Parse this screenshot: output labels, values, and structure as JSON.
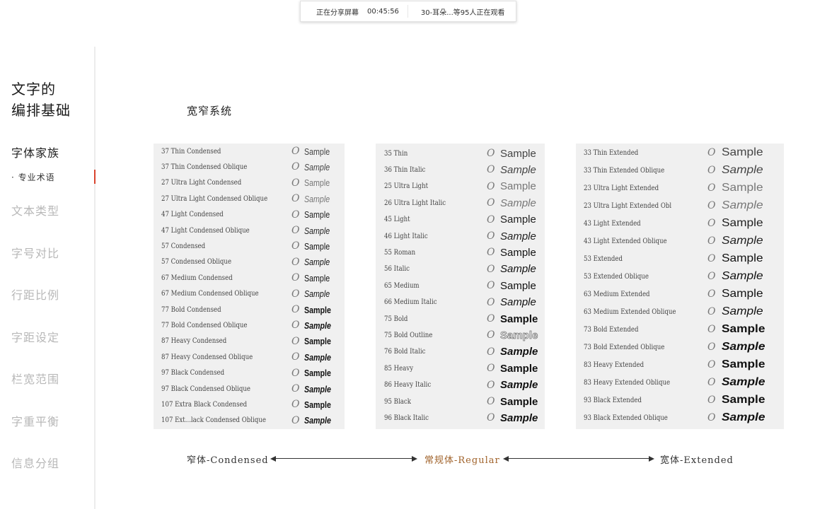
{
  "share_bar": {
    "status": "正在分享屏幕",
    "elapsed": "00:45:56",
    "viewers": "30-耳朵...等95人正在观看"
  },
  "sidebar": {
    "title_line1": "文字的",
    "title_line2": "编排基础",
    "items": [
      {
        "label": "字体家族",
        "state": "active"
      },
      {
        "label": "· 专业术语",
        "state": "current-sub"
      },
      {
        "label": "文本类型",
        "state": "inactive"
      },
      {
        "label": "字号对比",
        "state": "inactive"
      },
      {
        "label": "行距比例",
        "state": "inactive"
      },
      {
        "label": "字距设定",
        "state": "inactive"
      },
      {
        "label": "栏宽范围",
        "state": "inactive"
      },
      {
        "label": "字重平衡",
        "state": "inactive"
      },
      {
        "label": "信息分组",
        "state": "inactive"
      }
    ],
    "marker_color": "#d9442e"
  },
  "main": {
    "section_title": "宽窄系统",
    "glyph": "O",
    "sample_text": "Sample",
    "condensed": [
      {
        "name": "37 Thin Condensed",
        "style": "w100"
      },
      {
        "name": "37 Thin Condensed Oblique",
        "style": "w100 it"
      },
      {
        "name": "27 Ultra Light Condensed",
        "style": "w200"
      },
      {
        "name": "27 Ultra Light Condensed Oblique",
        "style": "w200 it"
      },
      {
        "name": "47 Light Condensed",
        "style": "w300"
      },
      {
        "name": "47 Light Condensed Oblique",
        "style": "w300 it"
      },
      {
        "name": "57 Condensed",
        "style": "w400"
      },
      {
        "name": "57 Condensed Oblique",
        "style": "w400 it"
      },
      {
        "name": "67 Medium Condensed",
        "style": "w500"
      },
      {
        "name": "67 Medium Condensed Oblique",
        "style": "w500 it"
      },
      {
        "name": "77 Bold Condensed",
        "style": "w700"
      },
      {
        "name": "77 Bold Condensed Oblique",
        "style": "w700 it"
      },
      {
        "name": "87 Heavy Condensed",
        "style": "w800"
      },
      {
        "name": "87 Heavy Condensed Oblique",
        "style": "w800 it"
      },
      {
        "name": "97 Black Condensed",
        "style": "w900"
      },
      {
        "name": "97 Black Condensed Oblique",
        "style": "w900 it"
      },
      {
        "name": "107 Extra Black Condensed",
        "style": "w900"
      },
      {
        "name": "107 Ext...lack Condensed Oblique",
        "style": "w900 it"
      }
    ],
    "regular": [
      {
        "name": "35 Thin",
        "style": "w100"
      },
      {
        "name": "36 Thin Italic",
        "style": "w100 it"
      },
      {
        "name": "25 Ultra Light",
        "style": "w200"
      },
      {
        "name": "26 Ultra Light Italic",
        "style": "w200 it"
      },
      {
        "name": "45 Light",
        "style": "w300"
      },
      {
        "name": "46 Light Italic",
        "style": "w300 it"
      },
      {
        "name": "55 Roman",
        "style": "w400"
      },
      {
        "name": "56 Italic",
        "style": "w400 it"
      },
      {
        "name": "65 Medium",
        "style": "w500"
      },
      {
        "name": "66 Medium Italic",
        "style": "w500 it"
      },
      {
        "name": "75 Bold",
        "style": "w700"
      },
      {
        "name": "75 Bold Outline",
        "style": "outline"
      },
      {
        "name": "76 Bold Italic",
        "style": "w700 it"
      },
      {
        "name": "85 Heavy",
        "style": "w800"
      },
      {
        "name": "86 Heavy Italic",
        "style": "w800 it"
      },
      {
        "name": "95 Black",
        "style": "w900"
      },
      {
        "name": "96 Black Italic",
        "style": "w900 it"
      }
    ],
    "extended": [
      {
        "name": "33 Thin Extended",
        "style": "w100"
      },
      {
        "name": "33 Thin Extended Oblique",
        "style": "w100 it"
      },
      {
        "name": "23 Ultra Light Extended",
        "style": "w200"
      },
      {
        "name": "23 Ultra Light Extended Obl",
        "style": "w200 it"
      },
      {
        "name": "43 Light Extended",
        "style": "w300"
      },
      {
        "name": "43 Light Extended Oblique",
        "style": "w300 it"
      },
      {
        "name": "53 Extended",
        "style": "w400"
      },
      {
        "name": "53 Extended Oblique",
        "style": "w400 it"
      },
      {
        "name": "63 Medium Extended",
        "style": "w500"
      },
      {
        "name": "63 Medium Extended Oblique",
        "style": "w500 it"
      },
      {
        "name": "73 Bold Extended",
        "style": "w700"
      },
      {
        "name": "73 Bold Extended Oblique",
        "style": "w700 it"
      },
      {
        "name": "83 Heavy Extended",
        "style": "w800"
      },
      {
        "name": "83 Heavy Extended Oblique",
        "style": "w800 it"
      },
      {
        "name": "93 Black Extended",
        "style": "w900"
      },
      {
        "name": "93 Black Extended Oblique",
        "style": "w900 it"
      }
    ],
    "scale": {
      "condensed": "窄体-Condensed",
      "regular": "常规体-Regular",
      "extended": "宽体-Extended",
      "accent_color": "#a0622a"
    }
  }
}
